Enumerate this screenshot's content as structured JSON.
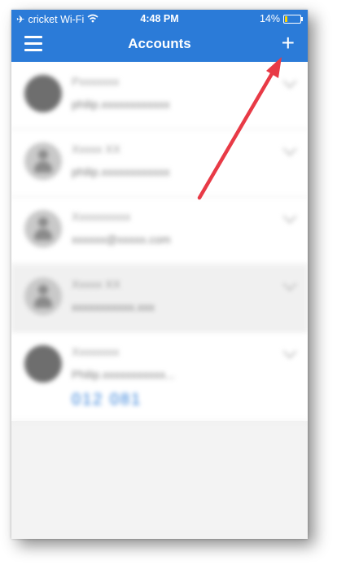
{
  "status_bar": {
    "carrier": "cricket Wi-Fi",
    "time": "4:48 PM",
    "battery": "14%"
  },
  "header": {
    "title": "Accounts",
    "add_label": "+"
  },
  "accounts": [
    {
      "name": "Pxxxxxxx",
      "detail": "philip.xxxxxxxxxxxx"
    },
    {
      "name": "Xxxxx XX",
      "detail": "philip.xxxxxxxxxxxx"
    },
    {
      "name": "Xxxxxxxxxx",
      "detail": "xxxxxx@xxxxx.com"
    },
    {
      "name": "Xxxxx XX",
      "detail": "xxxxxxxxxxx.xxx"
    },
    {
      "name": "Xxxxxxxx",
      "detail": "Philip.xxxxxxxxxxx...",
      "code": "012 081"
    }
  ],
  "annotation": {
    "color": "#e83a46"
  }
}
